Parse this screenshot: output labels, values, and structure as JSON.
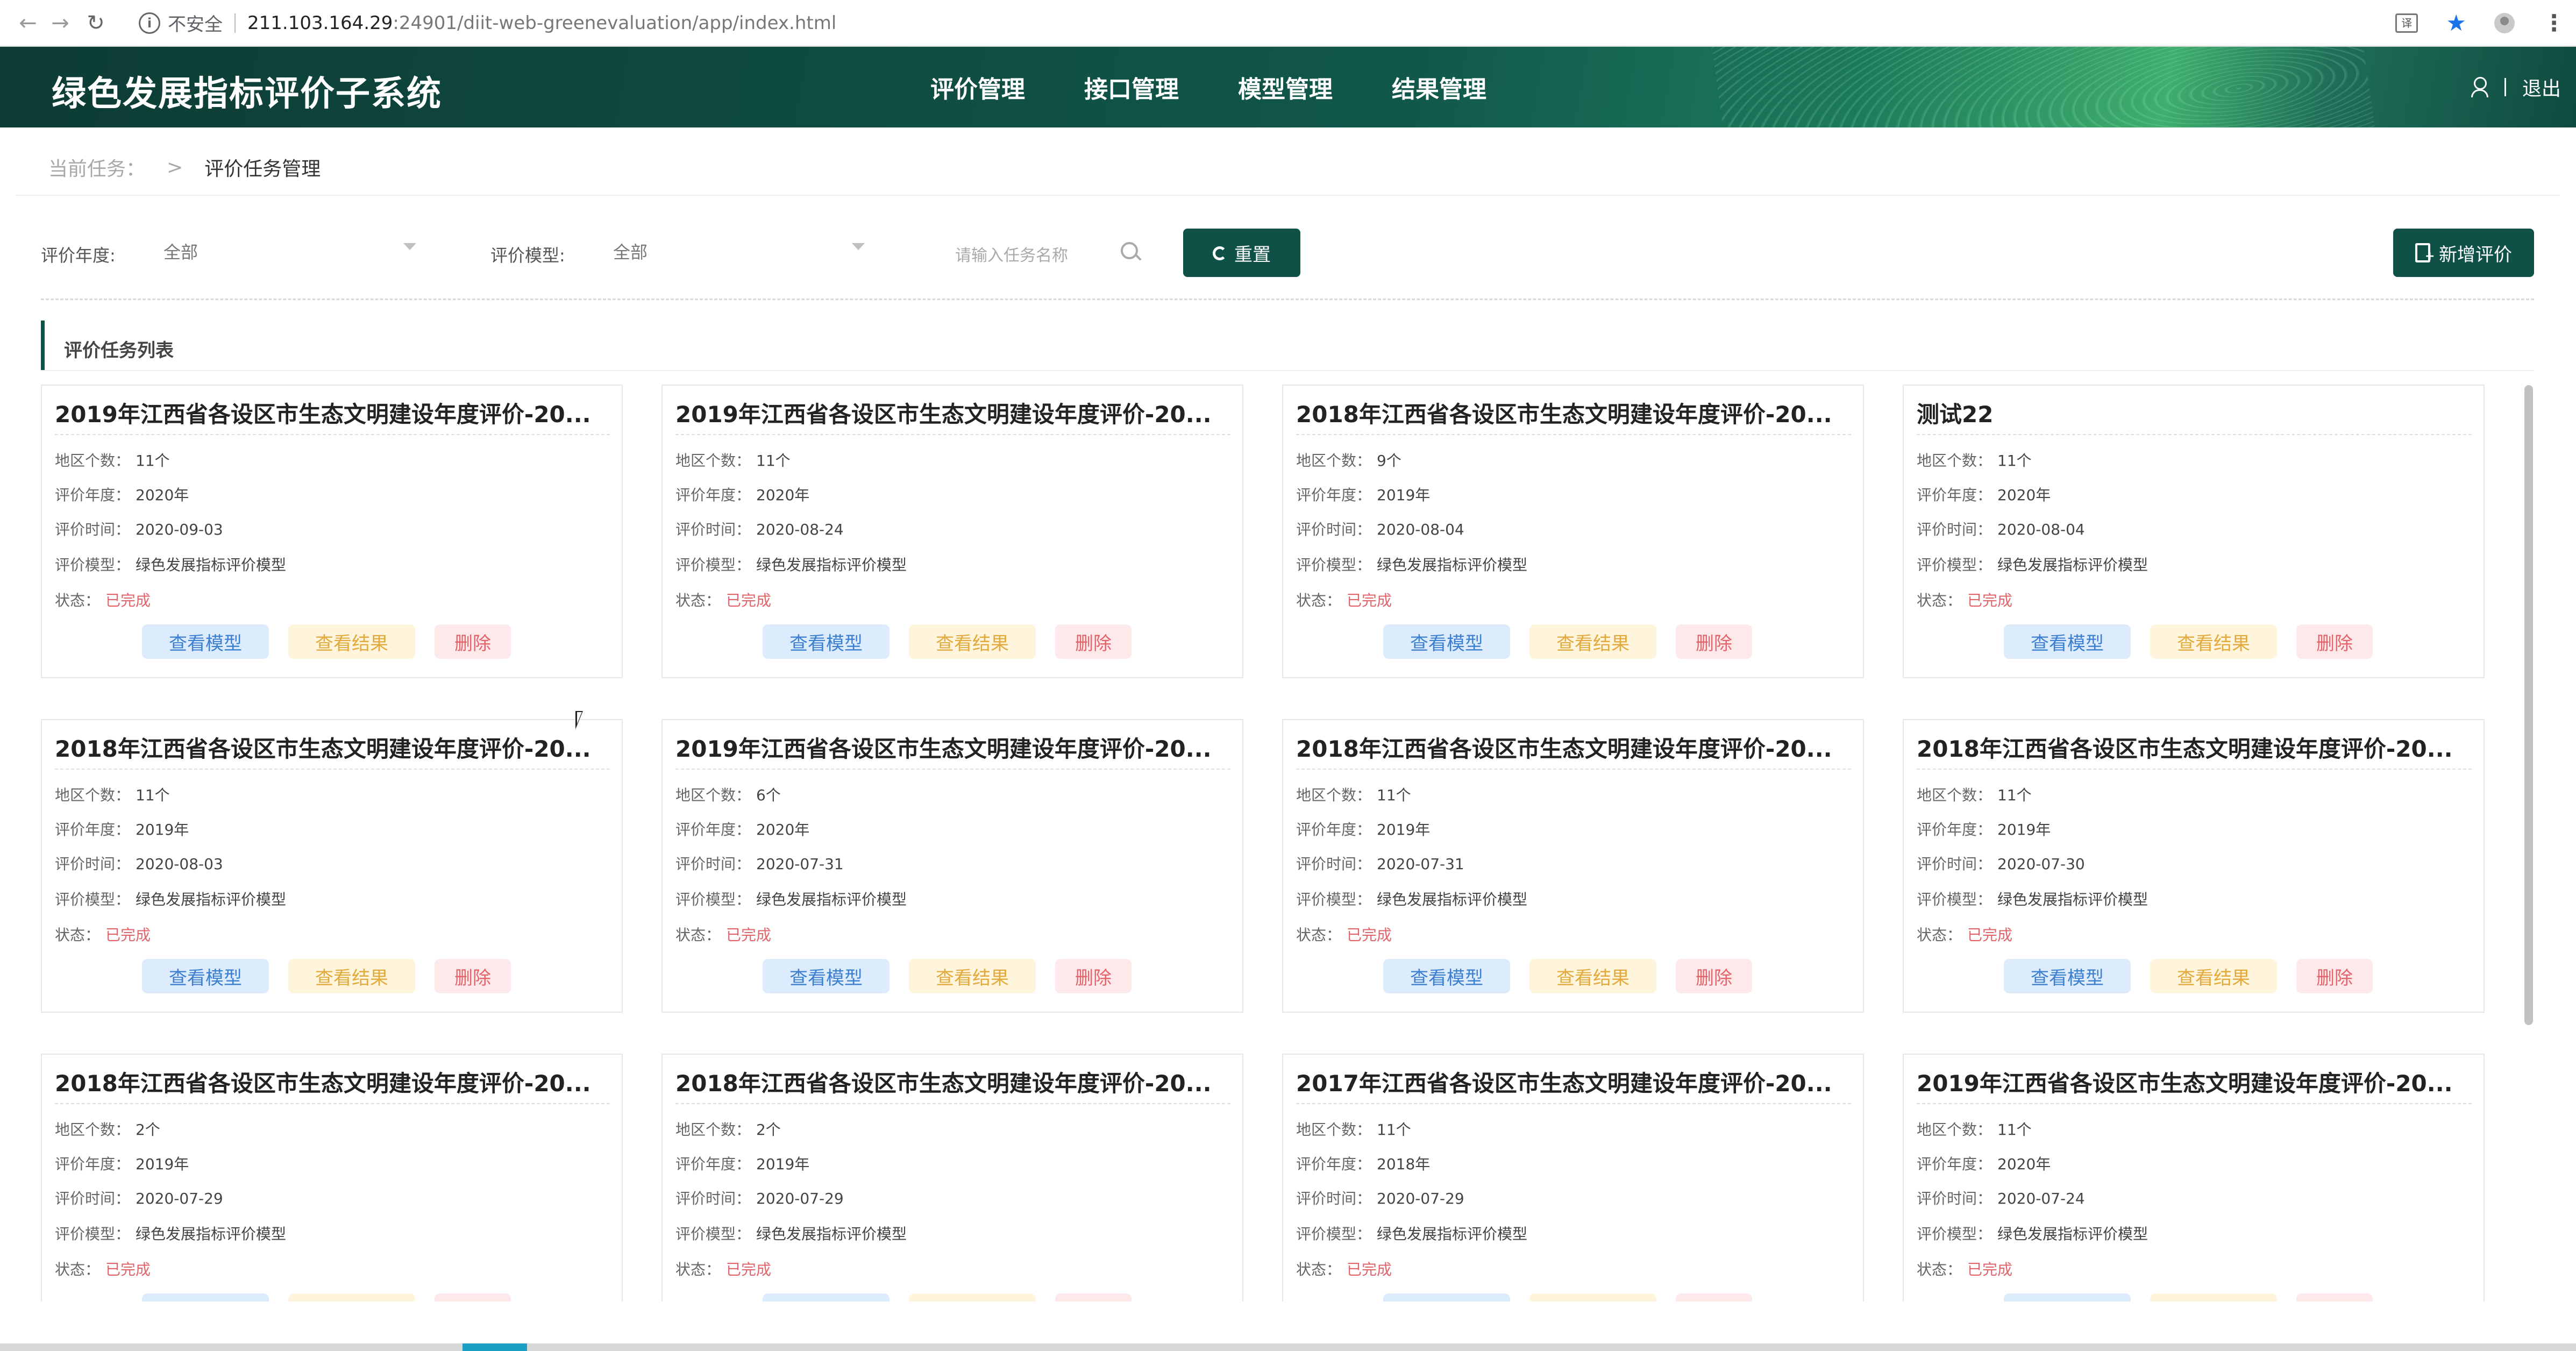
{
  "browser": {
    "insecure_label": "不安全",
    "url_host": "211.103.164.29",
    "url_rest": ":24901/diit-web-greenevaluation/app/index.html",
    "translate_label": "译"
  },
  "header": {
    "title": "绿色发展指标评价子系统",
    "nav": [
      "评价管理",
      "接口管理",
      "模型管理",
      "结果管理"
    ],
    "logout": "退出"
  },
  "breadcrumb": {
    "current_label": "当前任务：",
    "arrow": ">",
    "page": "评价任务管理"
  },
  "filters": {
    "year_label": "评价年度:",
    "year_value": "全部",
    "model_label": "评价模型:",
    "model_value": "全部",
    "search_placeholder": "请输入任务名称",
    "reset_label": "重置",
    "add_label": "新增评价"
  },
  "list": {
    "title": "评价任务列表",
    "field_labels": {
      "count": "地区个数：",
      "year": "评价年度：",
      "time": "评价时间：",
      "model": "评价模型：",
      "status": "状态："
    },
    "actions": {
      "view_model": "查看模型",
      "view_result": "查看结果",
      "delete": "删除"
    },
    "cards": [
      {
        "title": "2019年江西省各设区市生态文明建设年度评价-20...",
        "count": "11个",
        "year": "2020年",
        "time": "2020-09-03",
        "model": "绿色发展指标评价模型",
        "status": "已完成"
      },
      {
        "title": "2019年江西省各设区市生态文明建设年度评价-20...",
        "count": "11个",
        "year": "2020年",
        "time": "2020-08-24",
        "model": "绿色发展指标评价模型",
        "status": "已完成"
      },
      {
        "title": "2018年江西省各设区市生态文明建设年度评价-20...",
        "count": "9个",
        "year": "2019年",
        "time": "2020-08-04",
        "model": "绿色发展指标评价模型",
        "status": "已完成"
      },
      {
        "title": "测试22",
        "count": "11个",
        "year": "2020年",
        "time": "2020-08-04",
        "model": "绿色发展指标评价模型",
        "status": "已完成"
      },
      {
        "title": "2018年江西省各设区市生态文明建设年度评价-20...",
        "count": "11个",
        "year": "2019年",
        "time": "2020-08-03",
        "model": "绿色发展指标评价模型",
        "status": "已完成"
      },
      {
        "title": "2019年江西省各设区市生态文明建设年度评价-20...",
        "count": "6个",
        "year": "2020年",
        "time": "2020-07-31",
        "model": "绿色发展指标评价模型",
        "status": "已完成"
      },
      {
        "title": "2018年江西省各设区市生态文明建设年度评价-20...",
        "count": "11个",
        "year": "2019年",
        "time": "2020-07-31",
        "model": "绿色发展指标评价模型",
        "status": "已完成"
      },
      {
        "title": "2018年江西省各设区市生态文明建设年度评价-20...",
        "count": "11个",
        "year": "2019年",
        "time": "2020-07-30",
        "model": "绿色发展指标评价模型",
        "status": "已完成"
      },
      {
        "title": "2018年江西省各设区市生态文明建设年度评价-20...",
        "count": "2个",
        "year": "2019年",
        "time": "2020-07-29",
        "model": "绿色发展指标评价模型",
        "status": "已完成"
      },
      {
        "title": "2018年江西省各设区市生态文明建设年度评价-20...",
        "count": "2个",
        "year": "2019年",
        "time": "2020-07-29",
        "model": "绿色发展指标评价模型",
        "status": "已完成"
      },
      {
        "title": "2017年江西省各设区市生态文明建设年度评价-20...",
        "count": "11个",
        "year": "2018年",
        "time": "2020-07-29",
        "model": "绿色发展指标评价模型",
        "status": "已完成"
      },
      {
        "title": "2019年江西省各设区市生态文明建设年度评价-20...",
        "count": "11个",
        "year": "2020年",
        "time": "2020-07-24",
        "model": "绿色发展指标评价模型",
        "status": "已完成"
      }
    ]
  },
  "colors": {
    "brand": "#0f5147",
    "status_done": "#e2646a",
    "btn_model_bg": "#dcecfc",
    "btn_result_bg": "#fff5dc",
    "btn_delete_bg": "#fde9ea"
  },
  "icons": [
    "back-arrow-icon",
    "forward-arrow-icon",
    "reload-icon",
    "info-icon",
    "translate-icon",
    "star-icon",
    "profile-icon",
    "menu-dots-icon",
    "user-icon",
    "search-icon",
    "reset-icon",
    "add-document-icon",
    "chevron-down-icon"
  ]
}
